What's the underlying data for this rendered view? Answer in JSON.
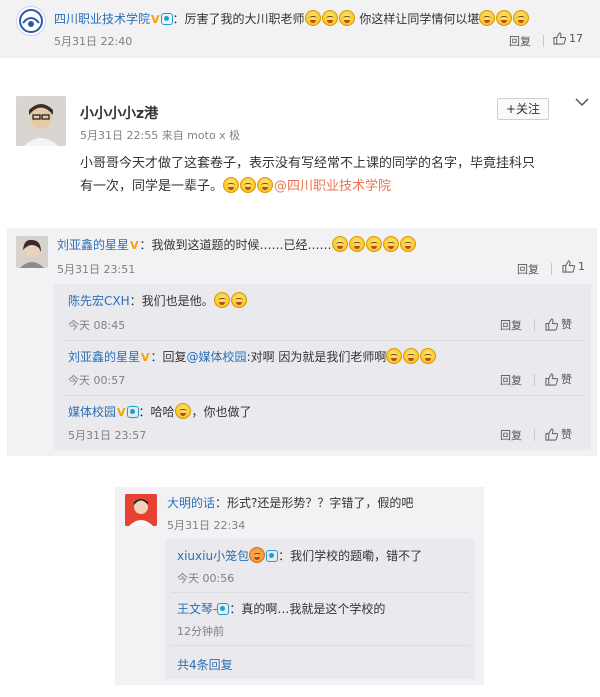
{
  "colors": {
    "accent": "#eb7350",
    "link_blue": "#2a6fb4",
    "panel_bg": "#f2f2f5"
  },
  "c1": {
    "name": "四川职业技术学院",
    "text": "：厉害了我的大川职老师",
    "text2": "你这样让同学情何以堪",
    "time": "5月31日 22:40",
    "reply": "回复",
    "likes": "17"
  },
  "post": {
    "name": "小小小小z港",
    "follow": "+关注",
    "meta": "5月31日 22:55 来自 moto x 极",
    "line1": "小哥哥今天才做了这套卷子，表示没有写经常不上课的同学的名字，毕竟挂科只",
    "line2": "有一次，同学是一辈子。",
    "mention": "@四川职业技术学院"
  },
  "c2": {
    "name": "刘亚鑫的星星",
    "text": "：我做到这道题的时候……已经……",
    "time": "5月31日 23:51",
    "reply": "回复",
    "likes": "1",
    "replies": [
      {
        "name": "陈先宏CXH",
        "text": "：我们也是他。",
        "time": "今天 08:45",
        "reply": "回复",
        "like": "赞"
      },
      {
        "name": "刘亚鑫的星星",
        "pre": "：回复",
        "mention": "@媒体校园",
        "text": ":对啊 因为就是我们老师啊",
        "time": "今天 00:57",
        "reply": "回复",
        "like": "赞"
      },
      {
        "name": "媒体校园",
        "text": "：哈哈",
        "text2": "，你也做了",
        "time": "5月31日 23:57",
        "reply": "回复",
        "like": "赞"
      }
    ]
  },
  "c3": {
    "name": "大明的话",
    "text": "：形式?还是形势？？字错了，假的吧",
    "time": "5月31日 22:34",
    "replies": [
      {
        "name": "xiuxiu小笼包",
        "text": "：我们学校的题嘞，错不了",
        "time": "今天 00:56"
      },
      {
        "name": "王文琴-",
        "text": "：真的啊…我就是这个学校的",
        "time": "12分钟前"
      }
    ],
    "more": "共4条回复"
  }
}
